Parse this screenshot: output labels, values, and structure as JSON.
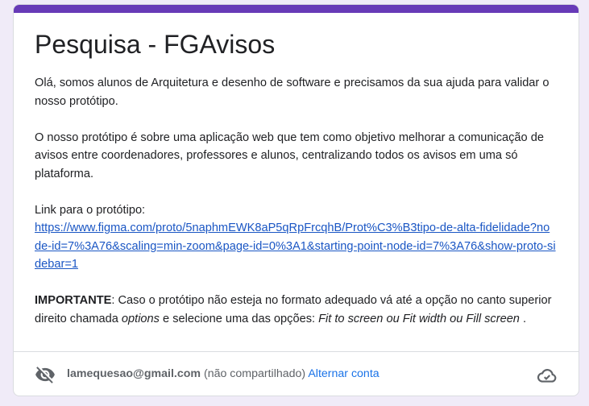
{
  "form": {
    "accent_color": "#673ab7",
    "title": "Pesquisa - FGAvisos",
    "para1": "Olá, somos alunos de Arquitetura e desenho de software e precisamos da sua ajuda para validar o nosso protótipo.",
    "para2": "O nosso protótipo é sobre uma aplicação web que tem como objetivo melhorar a comunicação de avisos entre coordenadores, professores e alunos, centralizando todos os avisos em uma só plataforma.",
    "link_label": "Link para o protótipo:",
    "link_url": "https://www.figma.com/proto/5naphmEWK8aP5qRpFrcqhB/Prot%C3%B3tipo-de-alta-fidelidade?node-id=7%3A76&scaling=min-zoom&page-id=0%3A1&starting-point-node-id=7%3A76&show-proto-sidebar=1",
    "important_label": "IMPORTANTE",
    "important_text_1": ": Caso o protótipo não esteja no formato adequado vá até a opção no canto superior direito chamada ",
    "important_options": "options",
    "important_text_2": " e selecione uma das opções: ",
    "important_choices": "Fit to screen ou Fit width ou Fill screen",
    "important_end": " ."
  },
  "account": {
    "email": "lamequesao@gmail.com",
    "share_status": "(não compartilhado)",
    "switch_label": "Alternar conta",
    "hidden_icon": "eye-off-icon",
    "cloud_icon": "cloud-done-icon"
  }
}
